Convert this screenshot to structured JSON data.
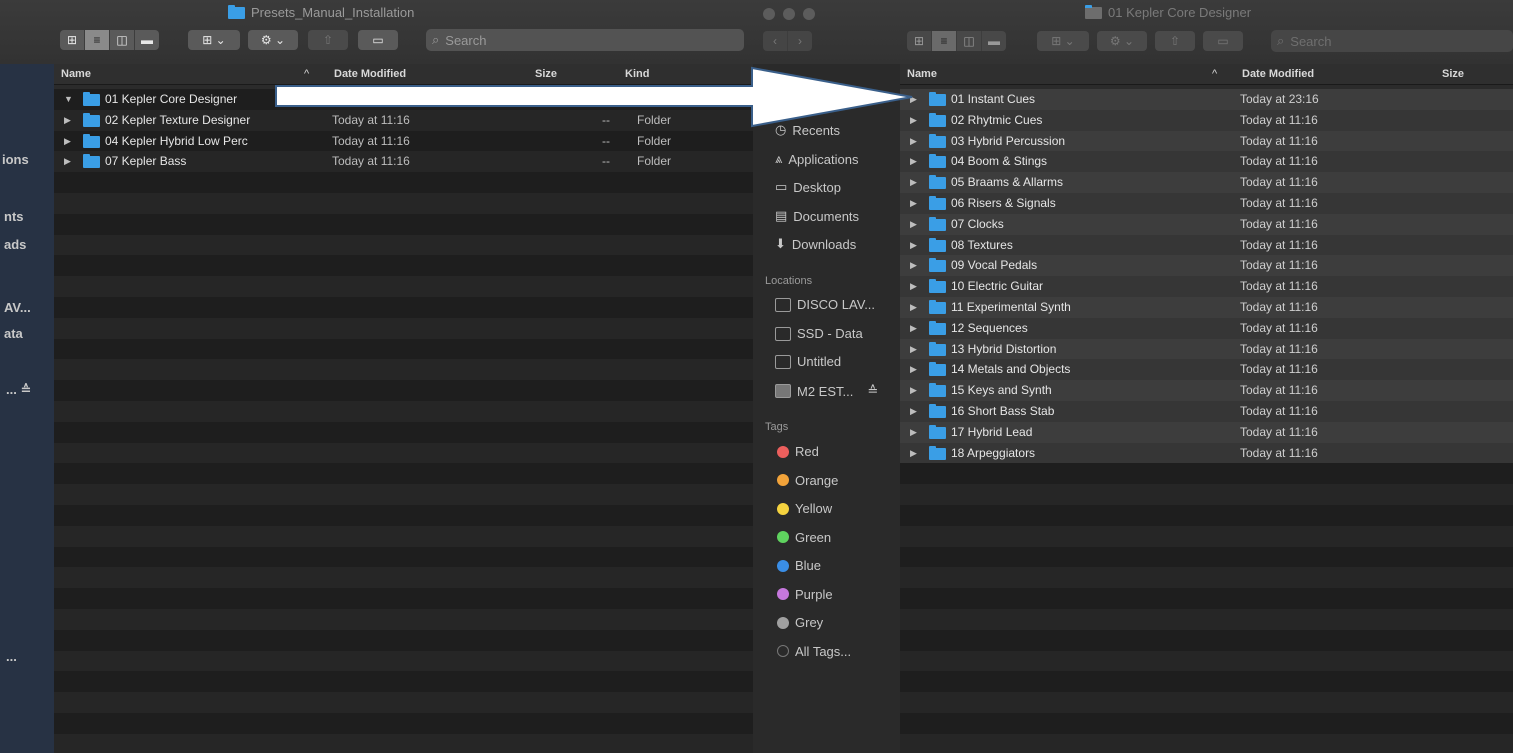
{
  "left_window": {
    "title": "Presets_Manual_Installation",
    "search_placeholder": "Search",
    "columns": {
      "name": "Name",
      "date": "Date Modified",
      "size": "Size",
      "kind": "Kind"
    },
    "rows": [
      {
        "name": "01 Kepler Core Designer",
        "date": "",
        "size": "",
        "kind": "",
        "expanded": true
      },
      {
        "name": "02 Kepler Texture Designer",
        "date": "Today at 11:16",
        "size": "--",
        "kind": "Folder"
      },
      {
        "name": "04 Kepler Hybrid Low Perc",
        "date": "Today at 11:16",
        "size": "--",
        "kind": "Folder"
      },
      {
        "name": "07 Kepler Bass",
        "date": "Today at 11:16",
        "size": "--",
        "kind": "Folder"
      }
    ],
    "sidebar_fragments": [
      "ions",
      "nts",
      "ads",
      "AV...",
      "ata",
      "... ≙",
      "..."
    ]
  },
  "right_window": {
    "title": "01 Kepler Core Designer",
    "search_placeholder": "Search",
    "columns": {
      "name": "Name",
      "date": "Date Modified",
      "size": "Size"
    },
    "rows": [
      {
        "name": "01 Instant Cues",
        "date": "Today at 23:16"
      },
      {
        "name": "02 Rhytmic Cues",
        "date": "Today at 11:16"
      },
      {
        "name": "03 Hybrid Percussion",
        "date": "Today at 11:16"
      },
      {
        "name": "04 Boom & Stings",
        "date": "Today at 11:16"
      },
      {
        "name": "05 Braams & Allarms",
        "date": "Today at 11:16"
      },
      {
        "name": "06 Risers & Signals",
        "date": "Today at 11:16"
      },
      {
        "name": "07 Clocks",
        "date": "Today at 11:16"
      },
      {
        "name": "08 Textures",
        "date": "Today at 11:16"
      },
      {
        "name": "09 Vocal Pedals",
        "date": "Today at 11:16"
      },
      {
        "name": "10 Electric Guitar",
        "date": "Today at 11:16"
      },
      {
        "name": "11 Experimental Synth",
        "date": "Today at 11:16"
      },
      {
        "name": "12 Sequences",
        "date": "Today at 11:16"
      },
      {
        "name": "13 Hybrid Distortion",
        "date": "Today at 11:16"
      },
      {
        "name": "14 Metals and Objects",
        "date": "Today at 11:16"
      },
      {
        "name": "15 Keys and Synth",
        "date": "Today at 11:16"
      },
      {
        "name": "16 Short Bass Stab",
        "date": "Today at 11:16"
      },
      {
        "name": "17 Hybrid Lead",
        "date": "Today at 11:16"
      },
      {
        "name": "18 Arpeggiators",
        "date": "Today at 11:16"
      }
    ],
    "sidebar": {
      "favorites": [
        {
          "label": "Recents",
          "icon": "recents-icon"
        },
        {
          "label": "Applications",
          "icon": "applications-icon"
        },
        {
          "label": "Desktop",
          "icon": "desktop-icon"
        },
        {
          "label": "Documents",
          "icon": "documents-icon"
        },
        {
          "label": "Downloads",
          "icon": "downloads-icon"
        }
      ],
      "locations_heading": "Locations",
      "locations": [
        {
          "label": "DISCO LAV...",
          "icon": "disk-icon"
        },
        {
          "label": "SSD - Data",
          "icon": "disk-icon"
        },
        {
          "label": "Untitled",
          "icon": "disk-icon"
        },
        {
          "label": "M2 EST...",
          "icon": "external-disk-icon",
          "eject": "≙"
        }
      ],
      "tags_heading": "Tags",
      "tags": [
        {
          "label": "Red",
          "color": "#ec5f5d"
        },
        {
          "label": "Orange",
          "color": "#f2a33a"
        },
        {
          "label": "Yellow",
          "color": "#f5d33f"
        },
        {
          "label": "Green",
          "color": "#5fd35f"
        },
        {
          "label": "Blue",
          "color": "#3a8ee6"
        },
        {
          "label": "Purple",
          "color": "#c678dd"
        },
        {
          "label": "Grey",
          "color": "#a0a0a0"
        },
        {
          "label": "All Tags...",
          "color": ""
        }
      ]
    }
  },
  "arrow_color": "#ffffff",
  "arrow_outline": "#3a5f8a"
}
